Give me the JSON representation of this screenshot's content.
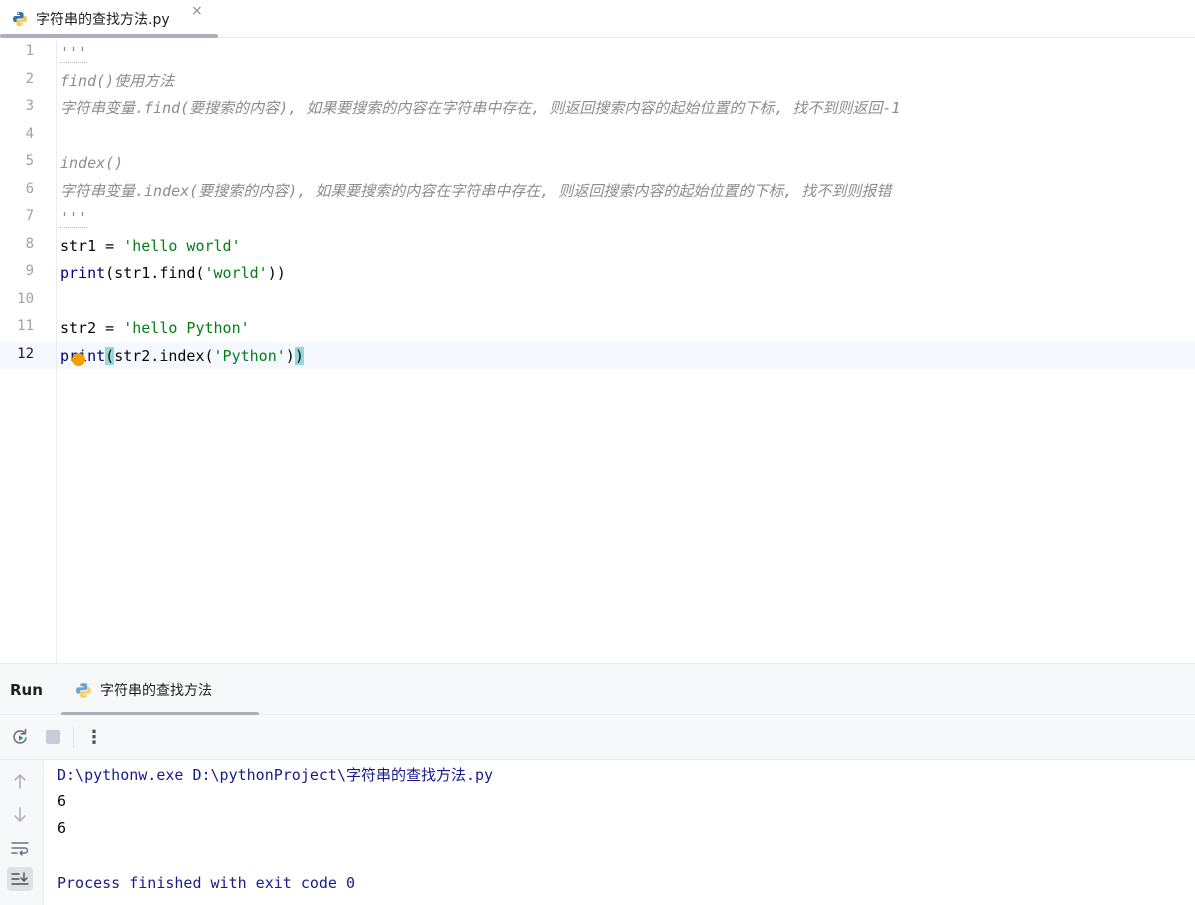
{
  "editor_tab": {
    "title": "字符串的查找方法.py",
    "close": "×"
  },
  "code_lines": [
    {
      "num": "1",
      "kind": "docquote",
      "text": "'''"
    },
    {
      "num": "2",
      "kind": "comment",
      "text": "find()使用方法"
    },
    {
      "num": "3",
      "kind": "comment",
      "text": "字符串变量.find(要搜索的内容), 如果要搜索的内容在字符串中存在, 则返回搜索内容的起始位置的下标, 找不到则返回-1"
    },
    {
      "num": "4",
      "kind": "blank",
      "text": ""
    },
    {
      "num": "5",
      "kind": "comment",
      "text": "index()"
    },
    {
      "num": "6",
      "kind": "comment",
      "text": "字符串变量.index(要搜索的内容), 如果要搜索的内容在字符串中存在, 则返回搜索内容的起始位置的下标, 找不到则报错"
    },
    {
      "num": "7",
      "kind": "docquote",
      "text": "'''"
    },
    {
      "num": "8",
      "kind": "code",
      "parts": [
        {
          "t": "str1 = ",
          "c": "op"
        },
        {
          "t": "'hello world'",
          "c": "str"
        }
      ]
    },
    {
      "num": "9",
      "kind": "code",
      "parts": [
        {
          "t": "print",
          "c": "fn"
        },
        {
          "t": "(str1.find(",
          "c": "op"
        },
        {
          "t": "'world'",
          "c": "str"
        },
        {
          "t": "))",
          "c": "op"
        }
      ]
    },
    {
      "num": "10",
      "kind": "blank",
      "text": ""
    },
    {
      "num": "11",
      "kind": "code",
      "parts": [
        {
          "t": "str2 = ",
          "c": "op"
        },
        {
          "t": "'hello Python'",
          "c": "str"
        }
      ]
    },
    {
      "num": "12",
      "kind": "code",
      "current": true,
      "parts": [
        {
          "t": "print",
          "c": "fn"
        },
        {
          "t": "(",
          "c": "op brace-hl"
        },
        {
          "t": "str2.index(",
          "c": "op"
        },
        {
          "t": "'Python'",
          "c": "str"
        },
        {
          "t": ")",
          "c": "op"
        },
        {
          "t": ")",
          "c": "op brace-hl"
        }
      ]
    }
  ],
  "run_panel": {
    "title": "Run",
    "tab_title": "字符串的查找方法",
    "tab_close": "×",
    "toolbar": {
      "rerun_icon": "rerun-icon",
      "stop_icon": "stop-icon",
      "more_icon": "more-vertical-icon",
      "more_label": "⋮"
    }
  },
  "console": {
    "lines": [
      {
        "text": "D:\\pythonw.exe D:\\pythonProject\\字符串的查找方法.py",
        "kind": "cmd"
      },
      {
        "text": "6",
        "kind": "out"
      },
      {
        "text": "6",
        "kind": "out"
      },
      {
        "text": "",
        "kind": "out"
      },
      {
        "text": "Process finished with exit code 0",
        "kind": "cmd"
      }
    ]
  },
  "colors": {
    "string": "#067d17",
    "builtin": "#000080",
    "comment": "#8c8c8c",
    "brace_highlight": "#93d9d9",
    "intention_bulb": "#f2a000"
  }
}
